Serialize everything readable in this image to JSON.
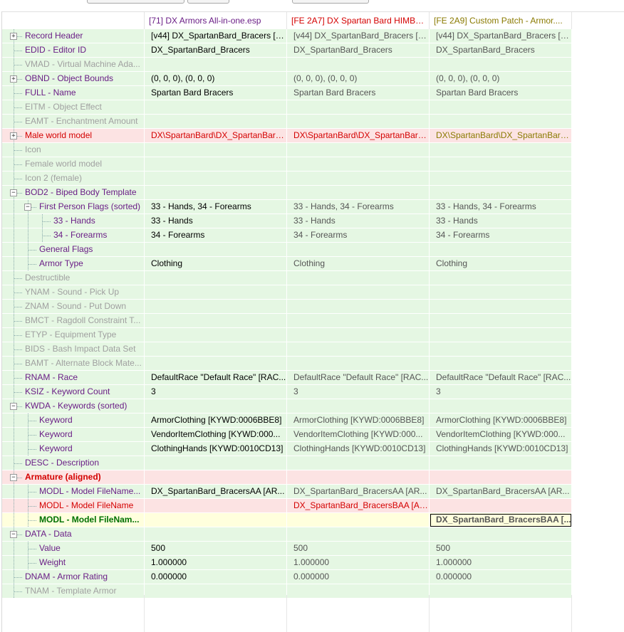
{
  "columns": [
    {
      "label": "",
      "color": "#000000"
    },
    {
      "label": "[71] DX Armors All-in-one.esp",
      "color": "#6a1e86"
    },
    {
      "label": "[FE 2A7] DX Spartan Bard HIMBO....",
      "color": "#d40000"
    },
    {
      "label": "[FE 2A9] Custom Patch - Armor....",
      "color": "#8a7a00"
    }
  ],
  "rows": [
    {
      "depth": 0,
      "exp": "+",
      "label": "Record Header",
      "lcls": "t-purple",
      "bg": "g",
      "vals": [
        "[v44] DX_SpartanBard_Bracers [A...",
        "[v44] DX_SpartanBard_Bracers [A...",
        "[v44] DX_SpartanBard_Bracers [A..."
      ]
    },
    {
      "depth": 0,
      "exp": "",
      "label": "EDID - Editor ID",
      "lcls": "t-purple",
      "bg": "g",
      "vals": [
        "DX_SpartanBard_Bracers",
        "DX_SpartanBard_Bracers",
        "DX_SpartanBard_Bracers"
      ]
    },
    {
      "depth": 0,
      "exp": "",
      "label": "VMAD - Virtual Machine Ada...",
      "lcls": "t-gray",
      "bg": "g",
      "vals": [
        "",
        "",
        ""
      ]
    },
    {
      "depth": 0,
      "exp": "+",
      "label": "OBND - Object Bounds",
      "lcls": "t-purple",
      "bg": "g",
      "vals": [
        "(0, 0, 0), (0, 0, 0)",
        "(0, 0, 0), (0, 0, 0)",
        "(0, 0, 0), (0, 0, 0)"
      ]
    },
    {
      "depth": 0,
      "exp": "",
      "label": "FULL - Name",
      "lcls": "t-purple",
      "bg": "g",
      "vals": [
        "Spartan Bard Bracers",
        "Spartan Bard Bracers",
        "Spartan Bard Bracers"
      ]
    },
    {
      "depth": 0,
      "exp": "",
      "label": "EITM - Object Effect",
      "lcls": "t-gray",
      "bg": "g",
      "vals": [
        "",
        "",
        ""
      ]
    },
    {
      "depth": 0,
      "exp": "",
      "label": "EAMT - Enchantment Amount",
      "lcls": "t-gray",
      "bg": "g",
      "vals": [
        "",
        "",
        ""
      ]
    },
    {
      "depth": 0,
      "exp": "+",
      "label": "Male world model",
      "lcls": "t-red",
      "bg": "r",
      "vals": [
        "DX\\SpartanBard\\DX_SpartanBard...",
        "DX\\SpartanBard\\DX_SpartanBard...",
        "DX\\SpartanBard\\DX_SpartanBard..."
      ]
    },
    {
      "depth": 0,
      "exp": "",
      "label": "Icon",
      "lcls": "t-gray",
      "bg": "g",
      "vals": [
        "",
        "",
        ""
      ]
    },
    {
      "depth": 0,
      "exp": "",
      "label": "Female world model",
      "lcls": "t-gray",
      "bg": "g",
      "vals": [
        "",
        "",
        ""
      ]
    },
    {
      "depth": 0,
      "exp": "",
      "label": "Icon 2 (female)",
      "lcls": "t-gray",
      "bg": "g",
      "vals": [
        "",
        "",
        ""
      ]
    },
    {
      "depth": 0,
      "exp": "-",
      "label": "BOD2 - Biped Body Template",
      "lcls": "t-purple",
      "bg": "g",
      "vals": [
        "",
        "",
        ""
      ]
    },
    {
      "depth": 1,
      "exp": "-",
      "label": "First Person Flags (sorted)",
      "lcls": "t-purple",
      "bg": "g",
      "vals": [
        "33 - Hands, 34 - Forearms",
        "33 - Hands, 34 - Forearms",
        "33 - Hands, 34 - Forearms"
      ]
    },
    {
      "depth": 2,
      "exp": "",
      "label": "33 - Hands",
      "lcls": "t-purple",
      "bg": "g",
      "vals": [
        "33 - Hands",
        "33 - Hands",
        "33 - Hands"
      ]
    },
    {
      "depth": 2,
      "exp": "",
      "label": "34 - Forearms",
      "lcls": "t-purple",
      "bg": "g",
      "vals": [
        "34 - Forearms",
        "34 - Forearms",
        "34 - Forearms"
      ]
    },
    {
      "depth": 1,
      "exp": "",
      "label": "General Flags",
      "lcls": "t-purple",
      "bg": "g",
      "vals": [
        "",
        "",
        ""
      ]
    },
    {
      "depth": 1,
      "exp": "",
      "label": "Armor Type",
      "lcls": "t-purple",
      "bg": "g",
      "vals": [
        "Clothing",
        "Clothing",
        "Clothing"
      ]
    },
    {
      "depth": 0,
      "exp": "",
      "label": "Destructible",
      "lcls": "t-gray",
      "bg": "g",
      "vals": [
        "",
        "",
        ""
      ]
    },
    {
      "depth": 0,
      "exp": "",
      "label": "YNAM - Sound - Pick Up",
      "lcls": "t-gray",
      "bg": "g",
      "vals": [
        "",
        "",
        ""
      ]
    },
    {
      "depth": 0,
      "exp": "",
      "label": "ZNAM - Sound - Put Down",
      "lcls": "t-gray",
      "bg": "g",
      "vals": [
        "",
        "",
        ""
      ]
    },
    {
      "depth": 0,
      "exp": "",
      "label": "BMCT - Ragdoll Constraint T...",
      "lcls": "t-gray",
      "bg": "g",
      "vals": [
        "",
        "",
        ""
      ]
    },
    {
      "depth": 0,
      "exp": "",
      "label": "ETYP - Equipment Type",
      "lcls": "t-gray",
      "bg": "g",
      "vals": [
        "",
        "",
        ""
      ]
    },
    {
      "depth": 0,
      "exp": "",
      "label": "BIDS - Bash Impact Data Set",
      "lcls": "t-gray",
      "bg": "g",
      "vals": [
        "",
        "",
        ""
      ]
    },
    {
      "depth": 0,
      "exp": "",
      "label": "BAMT - Alternate Block Mate...",
      "lcls": "t-gray",
      "bg": "g",
      "vals": [
        "",
        "",
        ""
      ]
    },
    {
      "depth": 0,
      "exp": "",
      "label": "RNAM - Race",
      "lcls": "t-purple",
      "bg": "g",
      "vals": [
        "DefaultRace \"Default Race\" [RAC...",
        "DefaultRace \"Default Race\" [RAC...",
        "DefaultRace \"Default Race\" [RAC..."
      ]
    },
    {
      "depth": 0,
      "exp": "",
      "label": "KSIZ - Keyword Count",
      "lcls": "t-purple",
      "bg": "g",
      "vals": [
        "3",
        "3",
        "3"
      ]
    },
    {
      "depth": 0,
      "exp": "-",
      "label": "KWDA - Keywords (sorted)",
      "lcls": "t-purple",
      "bg": "g",
      "vals": [
        "",
        "",
        ""
      ]
    },
    {
      "depth": 1,
      "exp": "",
      "label": "Keyword",
      "lcls": "t-purple",
      "bg": "g",
      "vals": [
        "ArmorClothing [KYWD:0006BBE8]",
        "ArmorClothing [KYWD:0006BBE8]",
        "ArmorClothing [KYWD:0006BBE8]"
      ]
    },
    {
      "depth": 1,
      "exp": "",
      "label": "Keyword",
      "lcls": "t-purple",
      "bg": "g",
      "vals": [
        "VendorItemClothing [KYWD:000...",
        "VendorItemClothing [KYWD:000...",
        "VendorItemClothing [KYWD:000..."
      ]
    },
    {
      "depth": 1,
      "exp": "",
      "label": "Keyword",
      "lcls": "t-purple",
      "bg": "g",
      "vals": [
        "ClothingHands [KYWD:0010CD13]",
        "ClothingHands [KYWD:0010CD13]",
        "ClothingHands [KYWD:0010CD13]"
      ]
    },
    {
      "depth": 0,
      "exp": "",
      "label": "DESC - Description",
      "lcls": "t-purple",
      "bg": "g",
      "vals": [
        "",
        "",
        ""
      ]
    },
    {
      "depth": 0,
      "exp": "-",
      "label": "Armature (aligned)",
      "lcls": "t-redb",
      "bg": "r",
      "vals": [
        "",
        "",
        ""
      ]
    },
    {
      "depth": 1,
      "exp": "",
      "label": "MODL - Model FileName...",
      "lcls": "t-purple",
      "bg": "g",
      "vals": [
        "DX_SpartanBard_BracersAA [AR...",
        "DX_SpartanBard_BracersAA [AR...",
        "DX_SpartanBard_BracersAA [AR..."
      ]
    },
    {
      "depth": 1,
      "exp": "",
      "label": "MODL - Model FileName",
      "lcls": "t-red",
      "bg": "r",
      "vals": [
        "",
        "DX_SpartanBard_BracersBAA [AR...",
        ""
      ]
    },
    {
      "depth": 1,
      "exp": "",
      "label": "MODL - Model FileNam...",
      "lcls": "t-green",
      "bg": "y",
      "vals": [
        "",
        "",
        "DX_SpartanBard_BracersBAA [..."
      ]
    },
    {
      "depth": 0,
      "exp": "-",
      "label": "DATA - Data",
      "lcls": "t-purple",
      "bg": "g",
      "vals": [
        "",
        "",
        ""
      ]
    },
    {
      "depth": 1,
      "exp": "",
      "label": "Value",
      "lcls": "t-purple",
      "bg": "g",
      "vals": [
        "500",
        "500",
        "500"
      ]
    },
    {
      "depth": 1,
      "exp": "",
      "label": "Weight",
      "lcls": "t-purple",
      "bg": "g",
      "vals": [
        "1.000000",
        "1.000000",
        "1.000000"
      ]
    },
    {
      "depth": 0,
      "exp": "",
      "label": "DNAM - Armor Rating",
      "lcls": "t-purple",
      "bg": "g",
      "vals": [
        "0.000000",
        "0.000000",
        "0.000000"
      ]
    },
    {
      "depth": 0,
      "exp": "",
      "label": "TNAM - Template Armor",
      "lcls": "t-gray",
      "bg": "g",
      "vals": [
        "",
        "",
        ""
      ]
    }
  ]
}
